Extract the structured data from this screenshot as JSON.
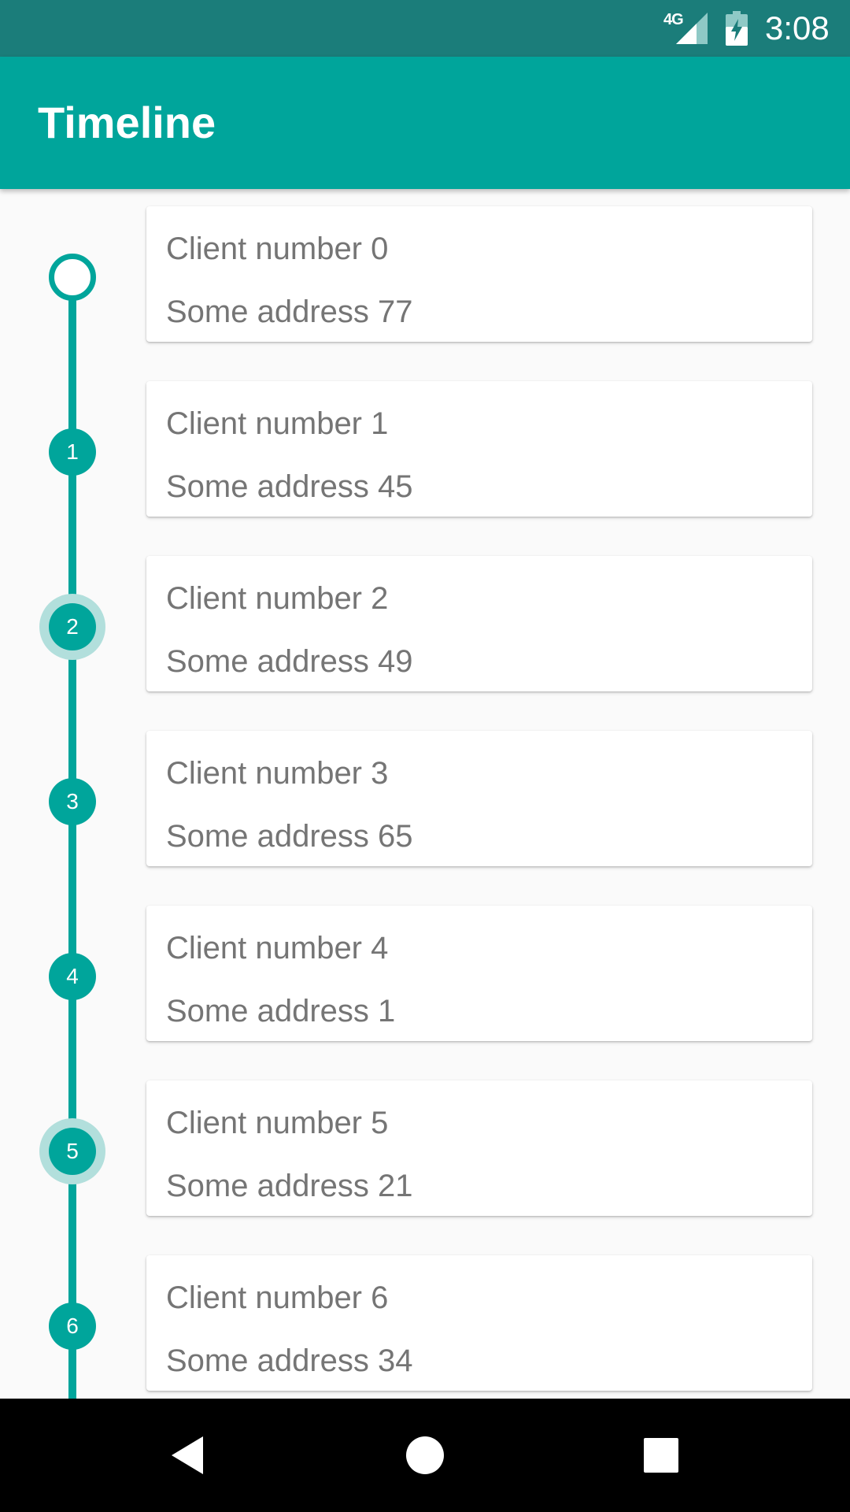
{
  "status_bar": {
    "network": "4G",
    "time": "3:08",
    "icons": [
      "signal-icon",
      "battery-charging-icon"
    ]
  },
  "app_bar": {
    "title": "Timeline"
  },
  "timeline": {
    "accent_color": "#00a59b",
    "items": [
      {
        "index": "0",
        "name": "Client number 0",
        "address": "Some address 77",
        "marker": "hollow"
      },
      {
        "index": "1",
        "name": "Client number 1",
        "address": "Some address 45",
        "marker": "filled"
      },
      {
        "index": "2",
        "name": "Client number 2",
        "address": "Some address 49",
        "marker": "highlighted"
      },
      {
        "index": "3",
        "name": "Client number 3",
        "address": "Some address 65",
        "marker": "filled"
      },
      {
        "index": "4",
        "name": "Client number 4",
        "address": "Some address 1",
        "marker": "filled"
      },
      {
        "index": "5",
        "name": "Client number 5",
        "address": "Some address 21",
        "marker": "highlighted"
      },
      {
        "index": "6",
        "name": "Client number 6",
        "address": "Some address 34",
        "marker": "filled"
      }
    ]
  },
  "nav_bar": {
    "buttons": [
      "back-icon",
      "home-icon",
      "recents-icon"
    ]
  }
}
